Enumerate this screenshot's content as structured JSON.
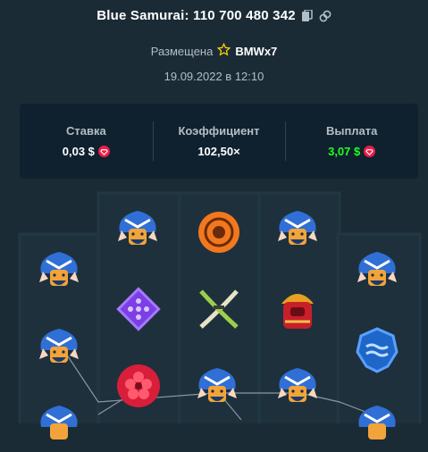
{
  "header": {
    "title": "Blue Samurai: 110 700 480 342",
    "copy_icon": "copy-icon",
    "link_icon": "link-icon"
  },
  "placed": {
    "prefix": "Размещена",
    "star_icon": "star-icon",
    "user": "BMWx7"
  },
  "date": "19.09.2022 в 12:10",
  "stats": {
    "bet_label": "Ставка",
    "bet_value": "0,03 $",
    "multiplier_label": "Коэффициент",
    "multiplier_value": "102,50×",
    "payout_label": "Выплата",
    "payout_value": "3,07 $",
    "currency_icon": "gem-coin-icon",
    "payout_color": "#1fff20"
  },
  "reels": [
    [
      "samurai",
      "samurai",
      "samurai"
    ],
    [
      "samurai",
      "purple-diamond",
      "red-flower"
    ],
    [
      "orange-orb",
      "crossed-swords",
      "samurai"
    ],
    [
      "samurai",
      "samurai-armor",
      "samurai"
    ],
    [
      "samurai",
      "blue-wave-medallion",
      "samurai"
    ]
  ],
  "colors": {
    "background": "#1b2b36",
    "panel": "#0f212e",
    "text_muted": "#b3bec6",
    "win_line": "#8899a6"
  }
}
